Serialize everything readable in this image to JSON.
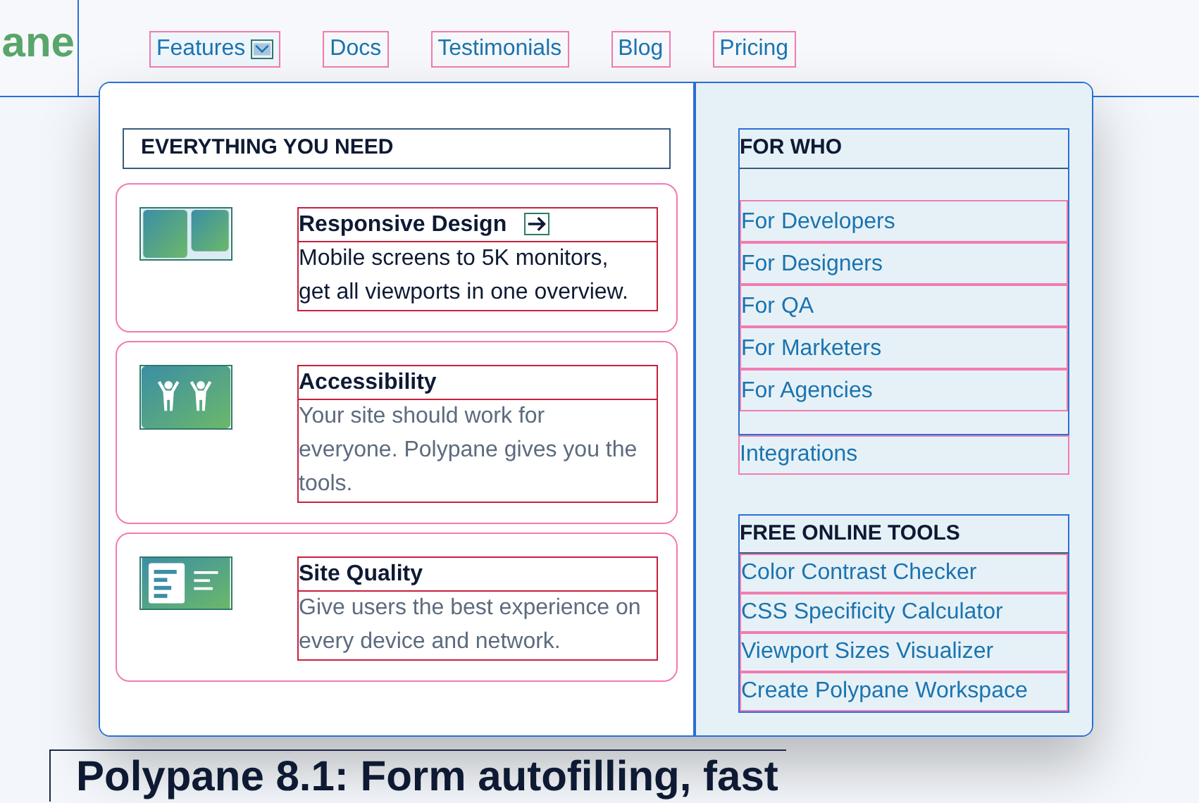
{
  "logo": {
    "text": "ane"
  },
  "nav": [
    {
      "label": "Features",
      "expanded": true
    },
    {
      "label": "Docs",
      "expanded": false
    },
    {
      "label": "Testimonials",
      "expanded": false
    },
    {
      "label": "Blog",
      "expanded": false
    },
    {
      "label": "Pricing",
      "expanded": false
    }
  ],
  "menu": {
    "heading": "EVERYTHING YOU NEED",
    "features": [
      {
        "kind": "viewports",
        "title": "Responsive Design",
        "arrow": true,
        "description": "Mobile screens to 5K monitors, get all viewports in one overview.",
        "muted": false
      },
      {
        "kind": "people",
        "title": "Accessibility",
        "arrow": false,
        "description": "Your site should work for everyone. Polypane gives you the tools.",
        "muted": true
      },
      {
        "kind": "report",
        "title": "Site Quality",
        "arrow": false,
        "description": "Give users the best experience on every device and network.",
        "muted": true
      }
    ],
    "for_who": {
      "heading": "FOR WHO",
      "links": [
        "For Developers",
        "For Designers",
        "For QA",
        "For Marketers",
        "For Agencies"
      ]
    },
    "integrations": "Integrations",
    "tools": {
      "heading": "FREE ONLINE TOOLS",
      "links": [
        "Color Contrast Checker",
        "CSS Specificity Calculator",
        "Viewport Sizes Visualizer",
        "Create Polypane Workspace"
      ]
    }
  },
  "headline": "Polypane 8.1: Form autofilling, fast"
}
